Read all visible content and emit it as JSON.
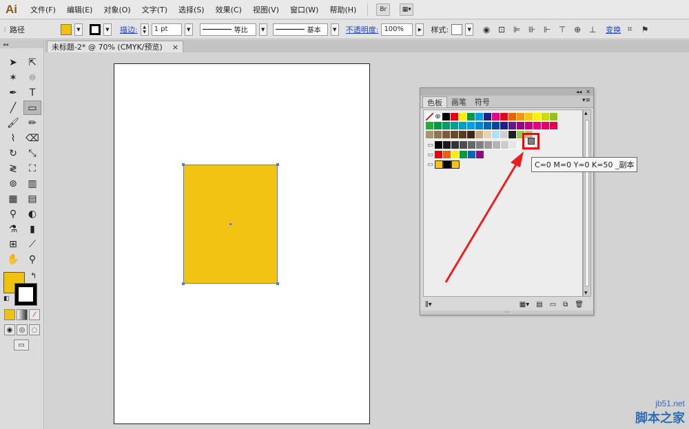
{
  "app": {
    "logo": "Ai"
  },
  "menu": [
    "文件(F)",
    "编辑(E)",
    "对象(O)",
    "文字(T)",
    "选择(S)",
    "效果(C)",
    "视图(V)",
    "窗口(W)",
    "帮助(H)"
  ],
  "menu_buttons": {
    "bridge": "Br"
  },
  "control_bar": {
    "object_type": "路径",
    "stroke_label": "描边:",
    "stroke_weight": "1 pt",
    "profile_label": "等比",
    "brush_label": "基本",
    "opacity_label": "不透明度:",
    "opacity_value": "100%",
    "style_label": "样式:",
    "transform_label": "变换"
  },
  "document_tab": {
    "title": "未标题-2* @ 70% (CMYK/预览)",
    "close": "×"
  },
  "swatches_panel": {
    "tabs": [
      "色板",
      "画笔",
      "符号"
    ],
    "active_tab": "色板",
    "tooltip": "C=0 M=0 Y=0 K=50 _副本",
    "rows": [
      [
        "#ffffff",
        "#ffffff",
        "#000000",
        "#e60012",
        "#fff100",
        "#009944",
        "#00a0e9",
        "#1d2088",
        "#e4007f",
        "#e60012",
        "#eb6100",
        "#f39800",
        "#fcc800",
        "#fff100",
        "#cfdb00",
        "#8fc31f"
      ],
      [
        "#22ac38",
        "#009944",
        "#009b6b",
        "#009e96",
        "#00a0c1",
        "#00a0e9",
        "#0086d1",
        "#0068b7",
        "#00479d",
        "#1d2088",
        "#601986",
        "#920783",
        "#be0081",
        "#e4007f",
        "#e5006a",
        "#e5004f"
      ],
      [
        "#a99470",
        "#8e7653",
        "#7a5b3a",
        "#6a4a2b",
        "#5a3b20",
        "#402616",
        "#c7a983",
        "#e8d2b0",
        "#b0e0ff",
        "#d0d0d0",
        "#202020",
        "#98c84c",
        "#cdb58a"
      ],
      [
        "#000000",
        "#1a1a1a",
        "#333333",
        "#4d4d4d",
        "#666666",
        "#808080",
        "#999999",
        "#b3b3b3",
        "#cccccc",
        "#e6e6e6",
        "#f2f2f2",
        "#ffffff"
      ],
      [
        "#e60012",
        "#eb6100",
        "#fff100",
        "#009944",
        "#0068b7",
        "#920783"
      ],
      [
        "#f2c313",
        "#000000",
        "#f2c313"
      ]
    ],
    "selected_swatch": "#808080"
  },
  "canvas": {
    "fill_color": "#f2c313",
    "selection_color": "#4e7fd8"
  },
  "toolbar": {
    "fill_color": "#f1c10f",
    "stroke_color": "#000000"
  },
  "watermark": {
    "domain": "jb51.net",
    "name": "脚本之家"
  }
}
